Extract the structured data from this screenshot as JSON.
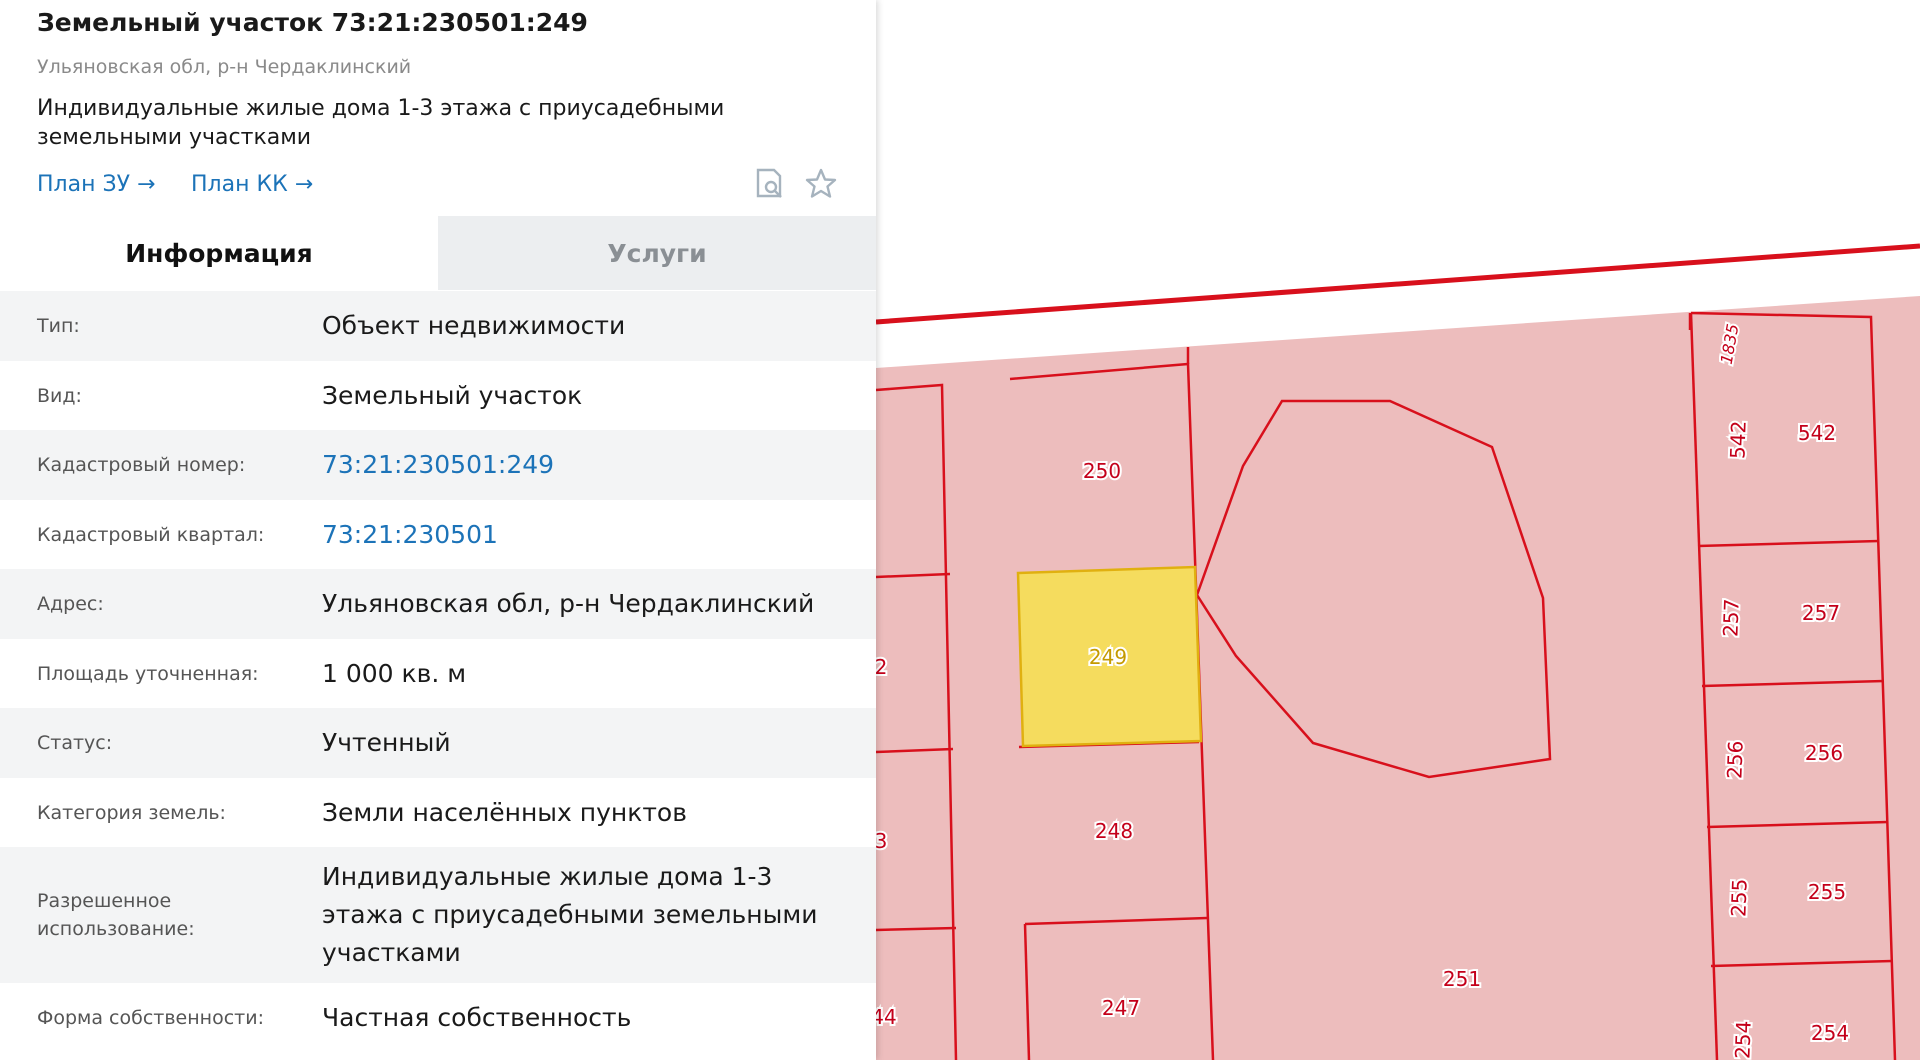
{
  "header": {
    "title": "Земельный участок 73:21:230501:249",
    "region": "Ульяновская обл, р-н Чердаклинский",
    "description": "Индивидуальные жилые дома 1-3 этажа с приусадебными земельными участками",
    "link_plan_zu": "План ЗУ →",
    "link_plan_kk": "План КК →",
    "icons": [
      "search-document-icon",
      "star-icon"
    ]
  },
  "tabs": [
    {
      "label": "Информация",
      "active": true
    },
    {
      "label": "Услуги",
      "active": false
    }
  ],
  "info": [
    {
      "label": "Тип:",
      "value": "Объект недвижимости"
    },
    {
      "label": "Вид:",
      "value": "Земельный участок"
    },
    {
      "label": "Кадастровый номер:",
      "value": "73:21:230501:249"
    },
    {
      "label": "Кадастровый квартал:",
      "value": "73:21:230501"
    },
    {
      "label": "Адрес:",
      "value": "Ульяновская обл, р-н Чердаклинский"
    },
    {
      "label": "Площадь уточненная:",
      "value": "1 000 кв. м"
    },
    {
      "label": "Статус:",
      "value": "Учтенный"
    },
    {
      "label": "Категория земель:",
      "value": "Земли населённых пунктов"
    },
    {
      "label": "Разрешенное использование:",
      "value": "Индивидуальные жилые дома 1-3 этажа с приусадебными земельными участками"
    },
    {
      "label": "Форма собственности:",
      "value": "Частная собственность"
    }
  ],
  "map": {
    "colors": {
      "parcel_fill": "#edbdbd",
      "parcel_line": "#d8101c",
      "selected_fill": "#f5dc5e",
      "selected_line": "#e0b010"
    },
    "selected_parcel": "249",
    "parcel_labels": [
      "250",
      "249",
      "248",
      "247",
      "251",
      "542",
      "257",
      "256",
      "255",
      "254",
      "1835",
      "2",
      "3",
      "44"
    ]
  }
}
